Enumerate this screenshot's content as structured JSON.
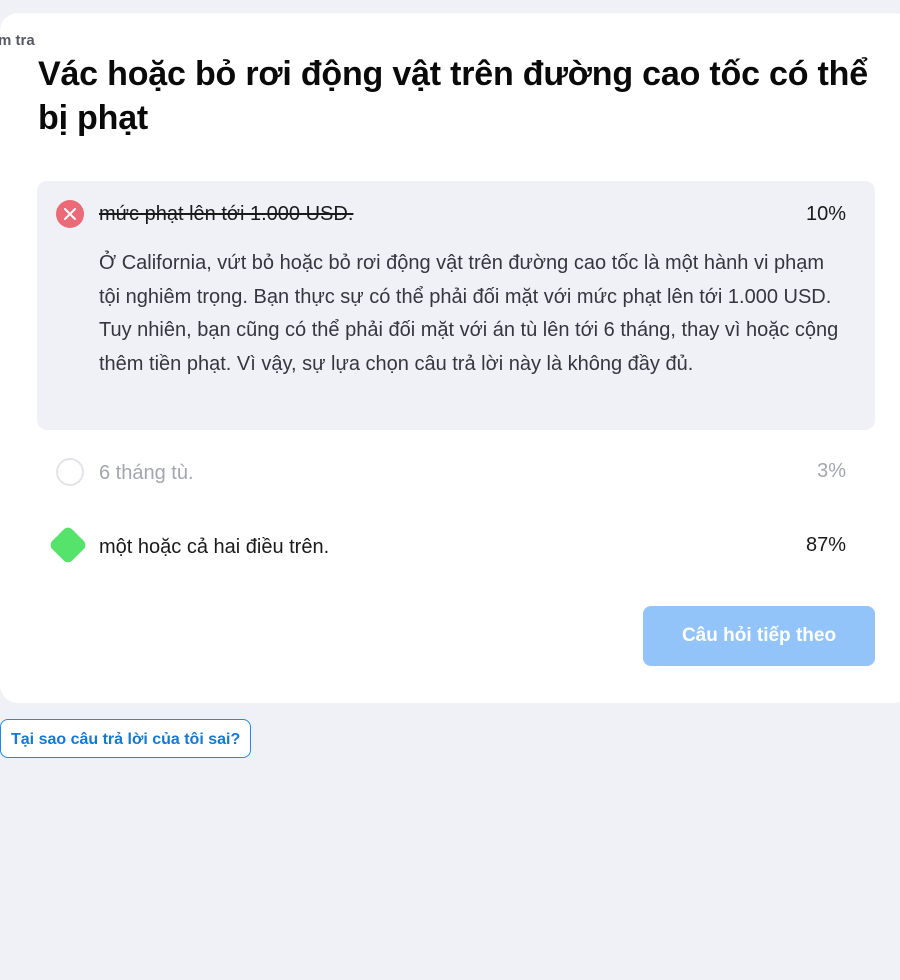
{
  "breadcrumb": "m tra",
  "question": "Vác hoặc bỏ rơi động vật trên đường cao tốc có thể bị phạt",
  "answers": [
    {
      "text": "mức phạt lên tới 1.000 USD.",
      "percent": "10%",
      "status": "wrong",
      "explanation": "Ở California, vứt bỏ hoặc bỏ rơi động vật trên đường cao tốc là một hành vi phạm tội nghiêm trọng. Bạn thực sự có thể phải đối mặt với mức phạt lên tới 1.000 USD. Tuy nhiên, bạn cũng có thể phải đối mặt với án tù lên tới 6 tháng, thay vì hoặc cộng thêm tiền phạt. Vì vậy, sự lựa chọn câu trả lời này là không đầy đủ."
    },
    {
      "text": "6 tháng tù.",
      "percent": "3%",
      "status": "unselected"
    },
    {
      "text": "một hoặc cả hai điều trên.",
      "percent": "87%",
      "status": "correct"
    }
  ],
  "next_button": "Câu hỏi tiếp theo",
  "why_wrong_link": "Tại sao câu trả lời của tôi sai?",
  "colors": {
    "wrong": "#ec6a78",
    "correct": "#55e36c",
    "button": "#92c4fa",
    "link": "#1479d4"
  }
}
